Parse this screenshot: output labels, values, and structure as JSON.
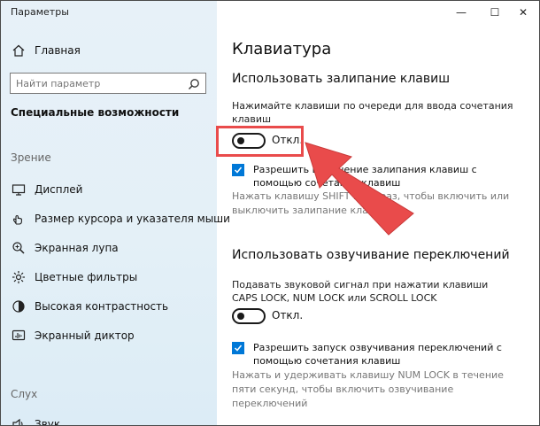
{
  "window": {
    "title": "Параметры"
  },
  "caption": {
    "minimize": "—",
    "maximize": "☐",
    "close": "✕"
  },
  "sidebar": {
    "home_label": "Главная",
    "search_placeholder": "Найти параметр",
    "section_title": "Специальные возможности",
    "group_vision": "Зрение",
    "items": [
      {
        "label": "Дисплей",
        "icon": "display-icon"
      },
      {
        "label": "Размер курсора и указателя мыши",
        "icon": "cursor-icon"
      },
      {
        "label": "Экранная лупа",
        "icon": "magnifier-icon"
      },
      {
        "label": "Цветные фильтры",
        "icon": "color-filter-icon"
      },
      {
        "label": "Высокая контрастность",
        "icon": "high-contrast-icon"
      },
      {
        "label": "Экранный диктор",
        "icon": "narrator-icon"
      }
    ],
    "group_hearing": "Слух",
    "sound_item": "Звук"
  },
  "main": {
    "page_title": "Клавиатура",
    "sticky": {
      "heading": "Использовать залипание клавиш",
      "desc": "Нажимайте клавиши по очереди для ввода сочетания клавиш",
      "toggle_label": "Откл.",
      "checkbox_label": "Разрешить включение залипания клавиш с помощью сочетания клавиш",
      "hint": "Нажать клавишу SHIFT пять раз, чтобы включить или выключить залипание клавиш"
    },
    "toggle_keys": {
      "heading": "Использовать озвучивание переключений",
      "desc": "Подавать звуковой сигнал при нажатии клавиши CAPS LOCK, NUM LOCK или SCROLL LOCK",
      "toggle_label": "Откл.",
      "checkbox_label": "Разрешить запуск озвучивания переключений с помощью сочетания клавиш",
      "hint": "Нажать и удерживать клавишу NUM LOCK в течение пяти секунд, чтобы включить озвучивание переключений"
    }
  },
  "colors": {
    "accent": "#0078d7",
    "annotation": "#e94b4b"
  }
}
